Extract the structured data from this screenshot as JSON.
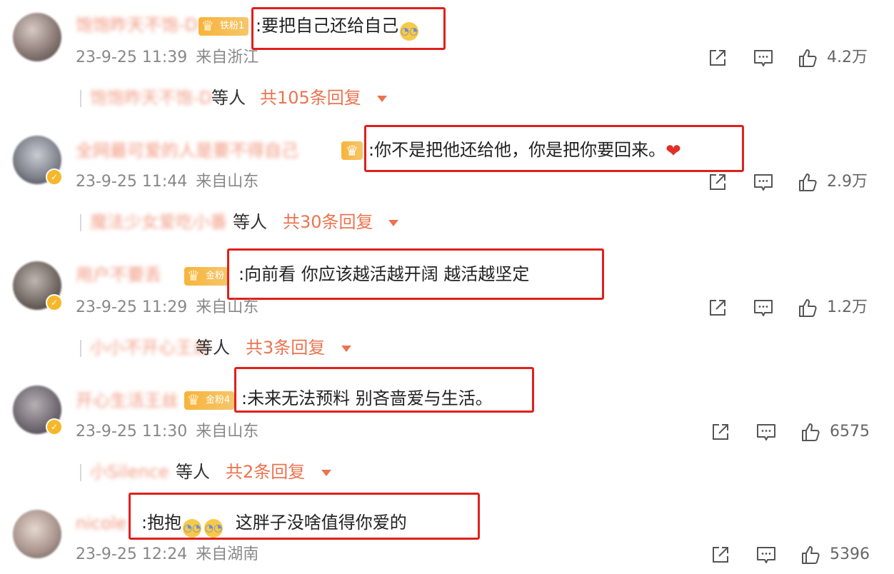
{
  "colors": {
    "accent": "#eb7350",
    "highlight_box": "#e0201c",
    "badge": "#f6b829"
  },
  "comments": [
    {
      "username": "饱饱昨天不饱-D",
      "fan_badge": "铁粉1",
      "text": ":要把自己还给自己",
      "time": "23-9-25 11:39",
      "location": "来自浙江",
      "likes": "4.2万",
      "reply_names": "饱饱昨天不饱-D",
      "reply_suffix": "等人",
      "reply_count": "共105条回复"
    },
    {
      "username": "全网最可爱的人是要不得自己",
      "text": ":你不是把他还给他，你是把你要回来。",
      "time": "23-9-25 11:44",
      "location": "来自山东",
      "likes": "2.9万",
      "reply_names": "魔法少女爱吃小番",
      "reply_suffix": "等人",
      "reply_count": "共30条回复"
    },
    {
      "username": "用户不要丢",
      "fan_badge": "金粉",
      "text": ":向前看 你应该越活越开阔 越活越坚定",
      "time": "23-9-25 11:29",
      "location": "来自山东",
      "likes": "1.2万",
      "reply_names": "小小不开心王丝",
      "reply_suffix": "等人",
      "reply_count": "共3条回复"
    },
    {
      "username": "开心生活王丝",
      "fan_badge": "金粉4",
      "text": ":未来无法预料 别吝啬爱与生活。",
      "time": "23-9-25 11:30",
      "location": "来自山东",
      "likes": "6575",
      "reply_names": "小Silence",
      "reply_suffix": "等人",
      "reply_count": "共2条回复"
    },
    {
      "username": "nicole",
      "text_a": ":抱抱",
      "text_b": "这胖子没啥值得你爱的",
      "time": "23-9-25 12:24",
      "location": "来自湖南",
      "likes": "5396"
    }
  ]
}
